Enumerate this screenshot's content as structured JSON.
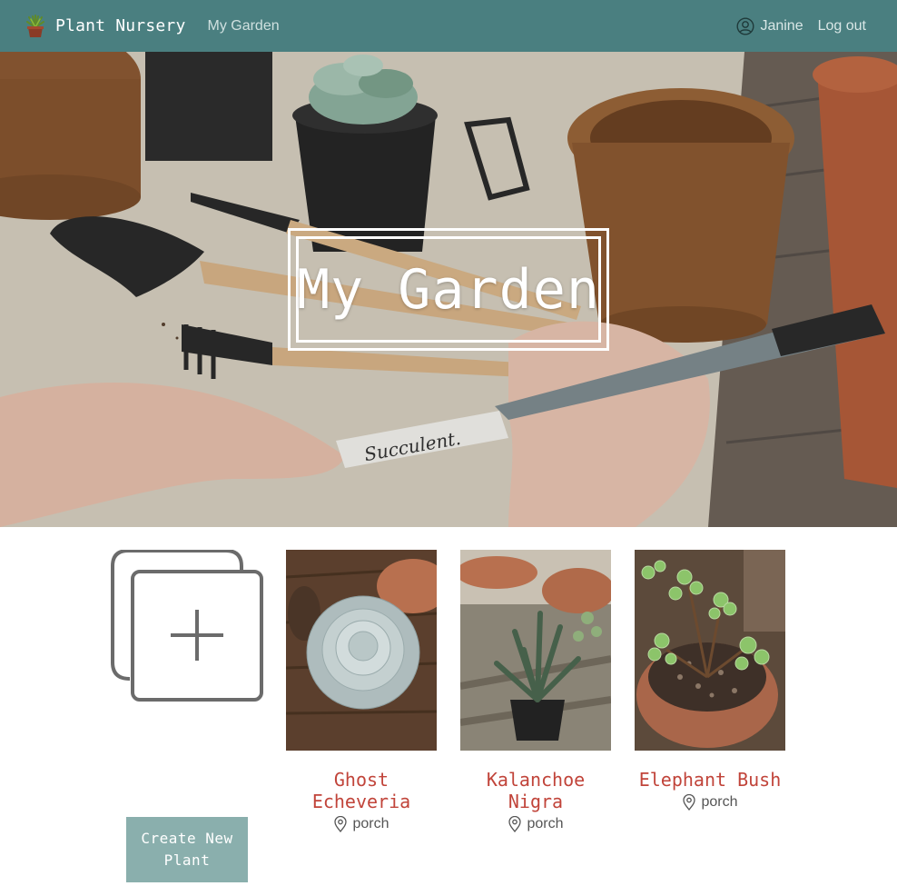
{
  "navbar": {
    "brand_name": "Plant Nursery",
    "brand_icon": "potted-plant-icon",
    "my_garden_link": "My Garden",
    "user_name": "Janine",
    "user_icon": "user-circle-icon",
    "logout_link": "Log out",
    "background_color": "#4a7f80"
  },
  "hero": {
    "title": "My Garden",
    "label_text": "Succulent."
  },
  "create": {
    "icon": "add-copy-icon",
    "button_label": "Create New Plant"
  },
  "plants": [
    {
      "name": "Ghost Echeveria",
      "location": "porch",
      "location_icon": "map-pin-icon"
    },
    {
      "name": "Kalanchoe Nigra",
      "location": "porch",
      "location_icon": "map-pin-icon"
    },
    {
      "name": "Elephant Bush",
      "location": "porch",
      "location_icon": "map-pin-icon"
    }
  ],
  "colors": {
    "accent": "#c1443a",
    "button": "#8aafad"
  }
}
